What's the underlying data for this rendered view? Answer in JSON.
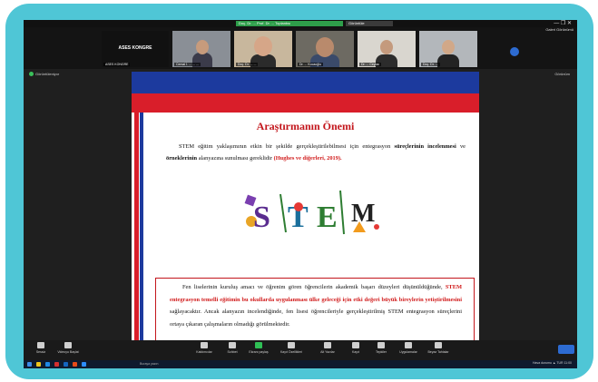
{
  "titlebar": {
    "meeting_label": "Doç. Dr. ... Prof. Dr. ... Toplantısı",
    "view_label": "Görüntüle",
    "window_controls": "—  ❐  ✕"
  },
  "participants": [
    {
      "name": "ASES KONGRE",
      "tile_text": "ASES KONGRE"
    },
    {
      "name": "Cemal İ. ... ... ..."
    },
    {
      "name": "Doç. Dr. ... ..."
    },
    {
      "name": "Dr. ... Kocaoğlu"
    },
    {
      "name": "Dr. ... Ceylan"
    },
    {
      "name": "Doç. Dr. ..."
    }
  ],
  "strip_right_label": "Galeri Görünümü",
  "subbar": {
    "share_label": "Görüntüleniyor",
    "view_options": "Görünüm"
  },
  "slide": {
    "title": "Araştırmanın Önemi",
    "para1_a": "STEM eğitim yaklaşımının etkin bir şekilde gerçekleştirilebilmesi için entegrasyon",
    "para1_b": "süreçlerinin incelenmesi",
    "para1_c": " ve ",
    "para1_d": "örneklerinin",
    "para1_e": " alanyazına sunulması gereklidir ",
    "para1_f": "(Hughes ve diğerleri, 2019).",
    "stem_letters": [
      "S",
      "T",
      "E",
      "M"
    ],
    "box_line1": "Fen liselerinin kuruluş amacı ve öğrenim gören öğrencilerin akademik başarı düzeyleri",
    "box_line2_a": "düşünüldüğünde, ",
    "box_line2_b": "STEM entegrasyon temelli eğitimin bu okullarda uygulanması ülke geleceği",
    "box_line3_a": "için etki değeri büyük bireylerin yetiştirilmesini",
    "box_line3_b": " sağlayacaktır. Ancak alanyazın incelendiğinde,",
    "box_line4": "fen lisesi öğrencileriyle gerçekleştirilmiş STEM entegrasyon süreçlerini ortaya çıkaran",
    "box_line5": "çalışmaların olmadığı görülmektedir."
  },
  "toolbar": {
    "items": [
      {
        "label": "Sessiz"
      },
      {
        "label": "Videoyu Başlat"
      },
      {
        "label": "Katılımcılar"
      },
      {
        "label": "Sohbet"
      },
      {
        "label": "Ekranı paylaş"
      },
      {
        "label": "Kayıt Özellikleri"
      },
      {
        "label": "Alt Yazılar"
      },
      {
        "label": "Kayıt"
      },
      {
        "label": "Tepkiler"
      },
      {
        "label": "Uygulamalar"
      },
      {
        "label": "Beyaz Tahtalar"
      }
    ],
    "end_label": "Bitir"
  },
  "taskbar": {
    "search_placeholder": "Buraya yazın",
    "tray_text": "Hava durumu  ▲  TUR  11:00"
  },
  "colors": {
    "frame": "#4fc6d6",
    "slide_blue": "#1c3a9e",
    "slide_red": "#d91e2a",
    "title_red": "#c3161c"
  }
}
